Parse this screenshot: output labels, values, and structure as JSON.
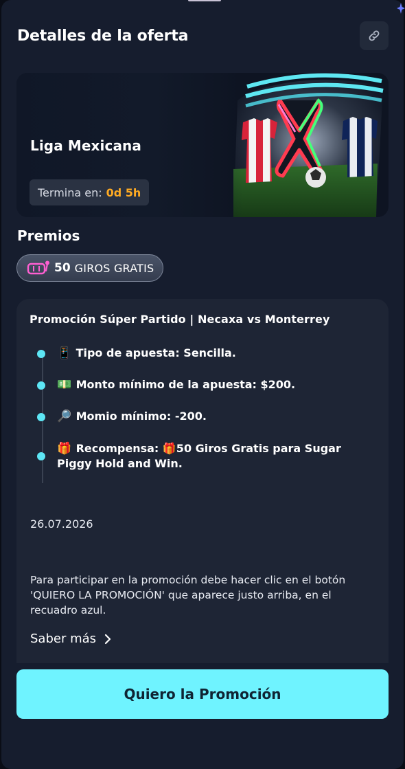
{
  "header": {
    "title": "Detalles de la oferta",
    "share_icon": "link-icon"
  },
  "offer": {
    "league": "Liga Mexicana",
    "ends_label": "Termina en:",
    "ends_value": "0d 5h"
  },
  "prizes": {
    "title": "Premios",
    "count": "50",
    "label": "GIROS GRATIS",
    "icon": "slot-machine-icon"
  },
  "details": {
    "title": "Promoción Súper Partido | Necaxa vs Monterrey",
    "items": [
      {
        "emoji": "📱",
        "text": "Tipo de apuesta: Sencilla."
      },
      {
        "emoji": "💵",
        "text": "Monto mínimo de la apuesta: $200."
      },
      {
        "emoji": "🔎",
        "text": "Momio mínimo: -200."
      },
      {
        "emoji": "🎁",
        "text": "Recompensa: 🎁50 Giros Gratis para Sugar Piggy Hold and Win."
      }
    ],
    "date": "26.07.2026",
    "paragraph": "Para participar en la promoción debe hacer clic en el botón 'QUIERO LA PROMOCIÓN' que aparece justo arriba, en el recuadro azul.",
    "more_label": "Saber más"
  },
  "cta": {
    "label": "Quiero la Promoción"
  },
  "colors": {
    "background": "#161d2e",
    "accent": "#6ff3ff",
    "timer": "#ffab23",
    "dot": "#5de6f5"
  }
}
